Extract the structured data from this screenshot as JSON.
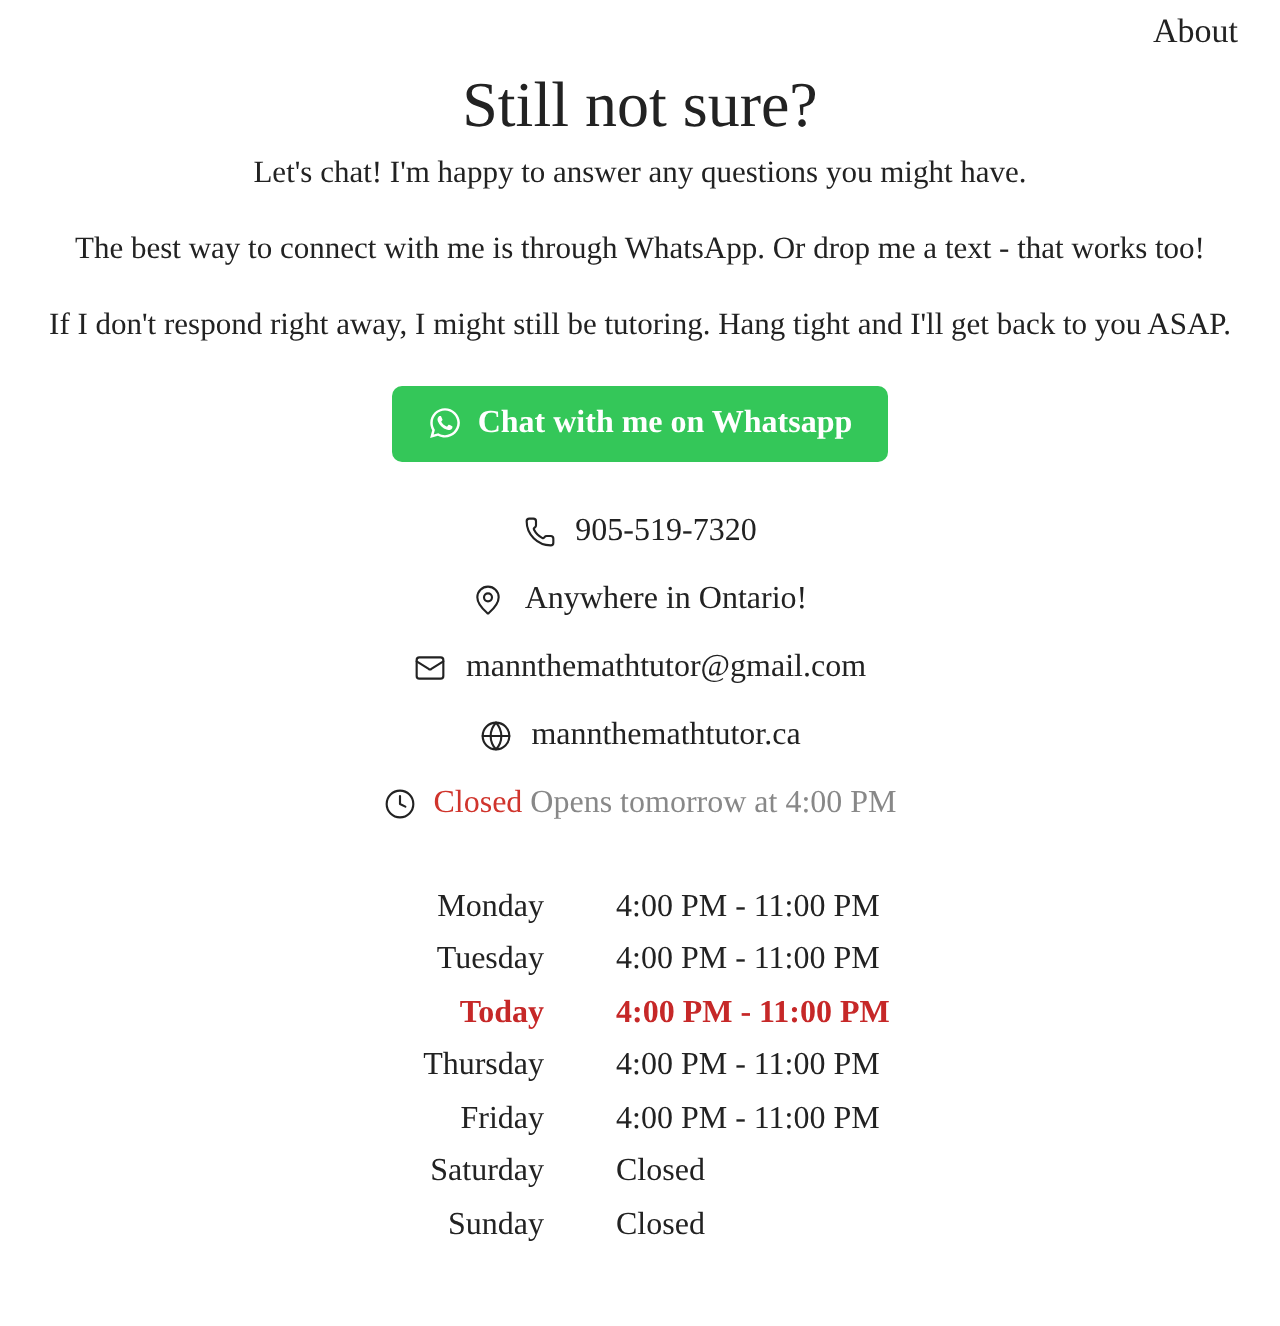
{
  "nav": {
    "link": "About"
  },
  "title": "Still not sure?",
  "paragraphs": [
    "Let's chat! I'm happy to answer any questions you might have.",
    "The best way to connect with me is through WhatsApp. Or drop me a text - that works too!",
    "If I don't respond right away, I might still be tutoring. Hang tight and I'll get back to you ASAP."
  ],
  "cta": {
    "label": "Chat with me on Whatsapp"
  },
  "contacts": [
    {
      "kind": "phone",
      "text": "905-519-7320"
    },
    {
      "kind": "location",
      "text": "Anywhere in Ontario!"
    },
    {
      "kind": "email",
      "text": "mannthemathtutor@gmail.com"
    },
    {
      "kind": "website",
      "text": "mannthemathtutor.ca"
    }
  ],
  "status": {
    "state": "Closed",
    "detail": "Opens tomorrow at 4:00 PM"
  },
  "hours": [
    {
      "day": "Monday",
      "time": "4:00 PM - 11:00 PM",
      "selected": false
    },
    {
      "day": "Tuesday",
      "time": "4:00 PM - 11:00 PM",
      "selected": false
    },
    {
      "day": "Today",
      "time": "4:00 PM - 11:00 PM",
      "selected": true
    },
    {
      "day": "Thursday",
      "time": "4:00 PM - 11:00 PM",
      "selected": false
    },
    {
      "day": "Friday",
      "time": "4:00 PM - 11:00 PM",
      "selected": false
    },
    {
      "day": "Saturday",
      "time": "Closed",
      "selected": false
    },
    {
      "day": "Sunday",
      "time": "Closed",
      "selected": false
    }
  ]
}
